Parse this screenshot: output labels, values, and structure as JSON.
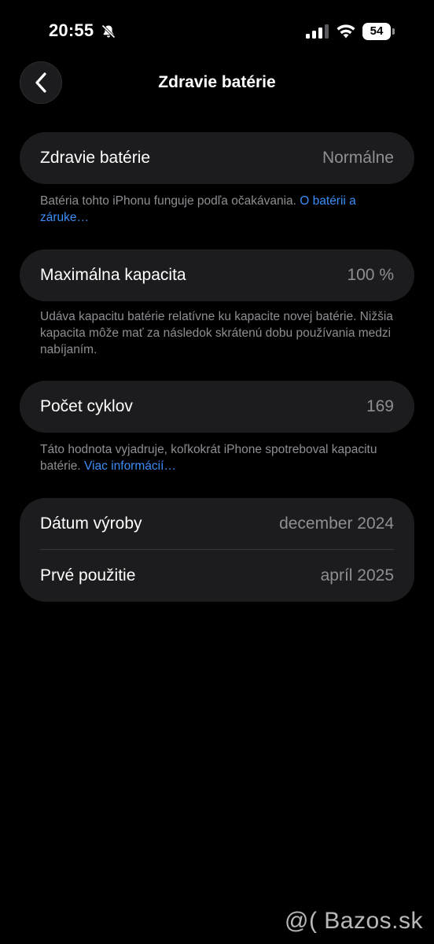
{
  "status_bar": {
    "time": "20:55",
    "battery_level": "54",
    "icons": [
      "bell-slash-icon",
      "cellular-signal-icon",
      "wifi-icon",
      "battery-icon"
    ]
  },
  "nav": {
    "title": "Zdravie batérie",
    "back_icon": "chevron-left-icon"
  },
  "health": {
    "label": "Zdravie batérie",
    "value": "Normálne",
    "note": "Batéria tohto iPhonu funguje podľa očakávania.",
    "note_link": "O batérii a záruke…"
  },
  "capacity": {
    "label": "Maximálna kapacita",
    "value": "100 %",
    "note": "Udáva kapacitu batérie relatívne ku kapacite novej batérie. Nižšia kapacita môže mať za následok skrátenú dobu používania medzi nabíjaním."
  },
  "cycles": {
    "label": "Počet cyklov",
    "value": "169",
    "note": "Táto hodnota vyjadruje, koľkokrát iPhone spotreboval kapacitu batérie.",
    "note_link": "Viac informácií…"
  },
  "dates": {
    "manufacture_label": "Dátum výroby",
    "manufacture_value": "december 2024",
    "first_use_label": "Prvé použitie",
    "first_use_value": "apríl 2025"
  },
  "watermark": "@( Bazos.sk",
  "colors": {
    "background": "#000000",
    "group": "#1c1c1e",
    "secondary_text": "#8e8e93",
    "link": "#3b8df7"
  }
}
